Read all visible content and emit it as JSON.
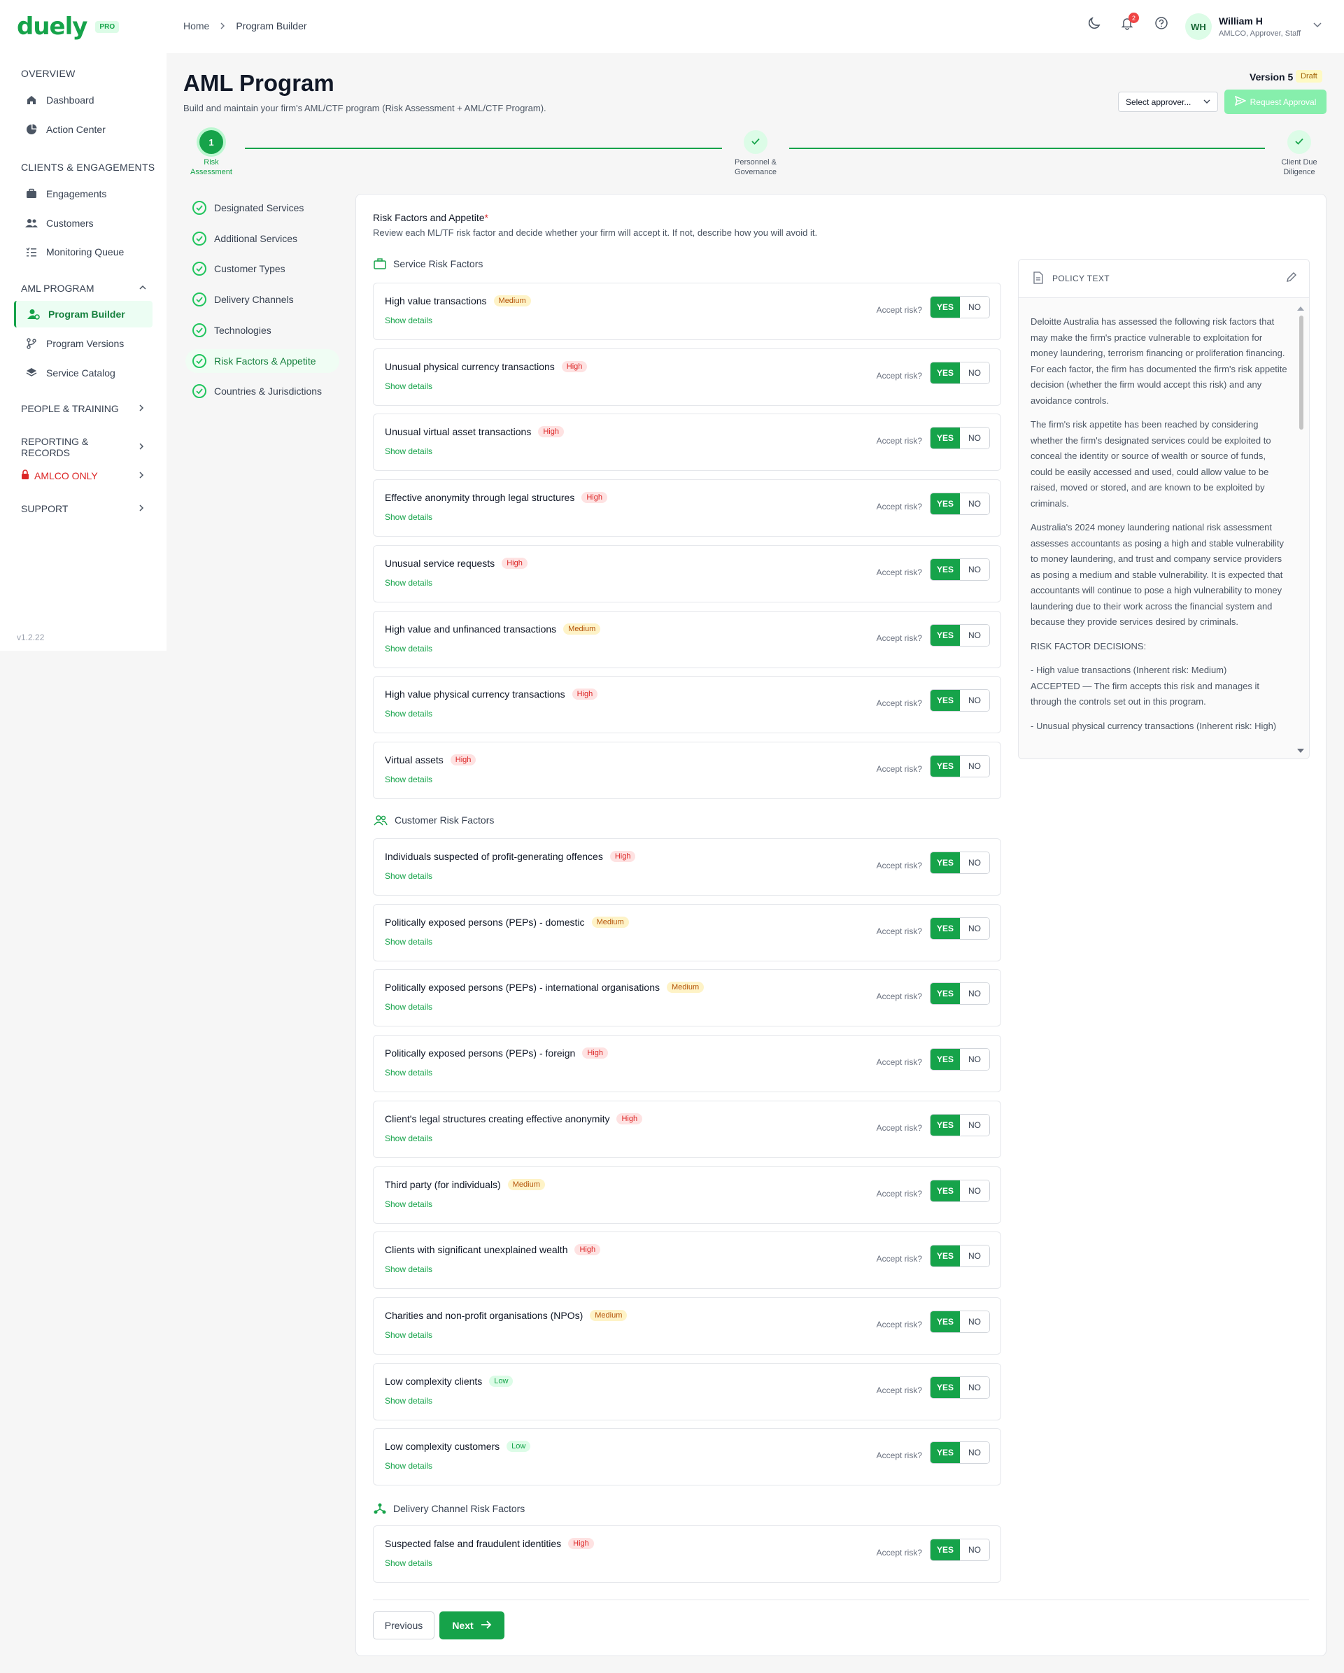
{
  "brand": {
    "name": "duely",
    "badge": "PRO",
    "version": "v1.2.22"
  },
  "sidebar": {
    "sections": [
      {
        "label": "OVERVIEW",
        "items": [
          {
            "label": "Dashboard",
            "icon": "home-icon"
          },
          {
            "label": "Action Center",
            "icon": "pie-icon"
          }
        ]
      },
      {
        "label": "CLIENTS & ENGAGEMENTS",
        "items": [
          {
            "label": "Engagements",
            "icon": "briefcase-icon"
          },
          {
            "label": "Customers",
            "icon": "users-icon"
          },
          {
            "label": "Monitoring Queue",
            "icon": "list-icon"
          }
        ]
      },
      {
        "label": "AML PROGRAM",
        "items": [
          {
            "label": "Program Builder",
            "icon": "user-gear-icon"
          },
          {
            "label": "Program Versions",
            "icon": "branch-icon"
          },
          {
            "label": "Service Catalog",
            "icon": "layers-icon"
          }
        ]
      }
    ],
    "groups": [
      "PEOPLE & TRAINING",
      "REPORTING & RECORDS",
      "AMLCO ONLY",
      "SUPPORT"
    ]
  },
  "breadcrumb": {
    "home": "Home",
    "current": "Program Builder"
  },
  "topbar": {
    "notifications": "2"
  },
  "user": {
    "initials": "WH",
    "name": "William H",
    "role": "AMLCO, Approver, Staff"
  },
  "header": {
    "title": "AML Program",
    "subtitle": "Build and maintain your firm's AML/CTF program (Risk Assessment + AML/CTF Program).",
    "version": "Version 5",
    "status": "Draft",
    "approver_placeholder": "Select approver...",
    "request_label": "Request Approval"
  },
  "stepper": [
    {
      "number": "1",
      "line1": "Risk",
      "line2": "Assessment",
      "state": "current"
    },
    {
      "number": "",
      "line1": "Personnel &",
      "line2": "Governance",
      "state": "done"
    },
    {
      "number": "",
      "line1": "Client Due",
      "line2": "Diligence",
      "state": "done"
    }
  ],
  "substeps": [
    "Designated Services",
    "Additional Services",
    "Customer Types",
    "Delivery Channels",
    "Technologies",
    "Risk Factors & Appetite",
    "Countries & Jurisdictions"
  ],
  "active_substep": "Risk Factors & Appetite",
  "section": {
    "title": "Risk Factors and Appetite",
    "required_mark": "*",
    "subtitle": "Review each ML/TF risk factor and decide whether your firm will accept it. If not, describe how you will avoid it."
  },
  "labels": {
    "accept": "Accept risk?",
    "yes": "YES",
    "no": "NO",
    "show_details": "Show details"
  },
  "groups": [
    {
      "title": "Service Risk Factors",
      "icon": "briefcase-icon",
      "factors": [
        {
          "name": "High value transactions",
          "level": "Medium",
          "accepted": true
        },
        {
          "name": "Unusual physical currency transactions",
          "level": "High",
          "accepted": true
        },
        {
          "name": "Unusual virtual asset transactions",
          "level": "High",
          "accepted": true
        },
        {
          "name": "Effective anonymity through legal structures",
          "level": "High",
          "accepted": true
        },
        {
          "name": "Unusual service requests",
          "level": "High",
          "accepted": true
        },
        {
          "name": "High value and unfinanced transactions",
          "level": "Medium",
          "accepted": true
        },
        {
          "name": "High value physical currency transactions",
          "level": "High",
          "accepted": true
        },
        {
          "name": "Virtual assets",
          "level": "High",
          "accepted": true
        }
      ]
    },
    {
      "title": "Customer Risk Factors",
      "icon": "users-icon",
      "factors": [
        {
          "name": "Individuals suspected of profit-generating offences",
          "level": "High",
          "accepted": true
        },
        {
          "name": "Politically exposed persons (PEPs) - domestic",
          "level": "Medium",
          "accepted": true
        },
        {
          "name": "Politically exposed persons (PEPs) - international organisations",
          "level": "Medium",
          "accepted": true
        },
        {
          "name": "Politically exposed persons (PEPs) - foreign",
          "level": "High",
          "accepted": true
        },
        {
          "name": "Client's legal structures creating effective anonymity",
          "level": "High",
          "accepted": true
        },
        {
          "name": "Third party (for individuals)",
          "level": "Medium",
          "accepted": true
        },
        {
          "name": "Clients with significant unexplained wealth",
          "level": "High",
          "accepted": true
        },
        {
          "name": "Charities and non-profit organisations (NPOs)",
          "level": "Medium",
          "accepted": true
        },
        {
          "name": "Low complexity clients",
          "level": "Low",
          "accepted": true
        },
        {
          "name": "Low complexity customers",
          "level": "Low",
          "accepted": true
        }
      ]
    },
    {
      "title": "Delivery Channel Risk Factors",
      "icon": "network-icon",
      "factors": [
        {
          "name": "Suspected false and fraudulent identities",
          "level": "High",
          "accepted": true
        }
      ]
    }
  ],
  "policy": {
    "heading": "POLICY TEXT",
    "paragraphs": [
      "Deloitte Australia has assessed the following risk factors that may make the firm's practice vulnerable to exploitation for money laundering, terrorism financing or proliferation financing. For each factor, the firm has documented the firm's risk appetite decision (whether the firm would accept this risk) and any avoidance controls.",
      "The firm's risk appetite has been reached by considering whether the firm's designated services could be exploited to conceal the identity or source of wealth or source of funds, could be easily accessed and used, could allow value to be raised, moved or stored, and are known to be exploited by criminals.",
      "Australia's 2024 money laundering national risk assessment assesses accountants as posing a high and stable vulnerability to money laundering, and trust and company service providers as posing a medium and stable vulnerability. It is expected that accountants will continue to pose a high vulnerability to money laundering due to their work across the financial system and because they provide services desired by criminals.",
      "RISK FACTOR DECISIONS:",
      "- High value transactions (Inherent risk: Medium)\n  ACCEPTED — The firm accepts this risk and manages it through the controls set out in this program.",
      "- Unusual physical currency transactions (Inherent risk: High)"
    ]
  },
  "footer": {
    "previous": "Previous",
    "next": "Next"
  },
  "colors": {
    "accent": "#16a34a",
    "high": "#dc2626",
    "medium": "#b45309",
    "low": "#16a34a"
  }
}
